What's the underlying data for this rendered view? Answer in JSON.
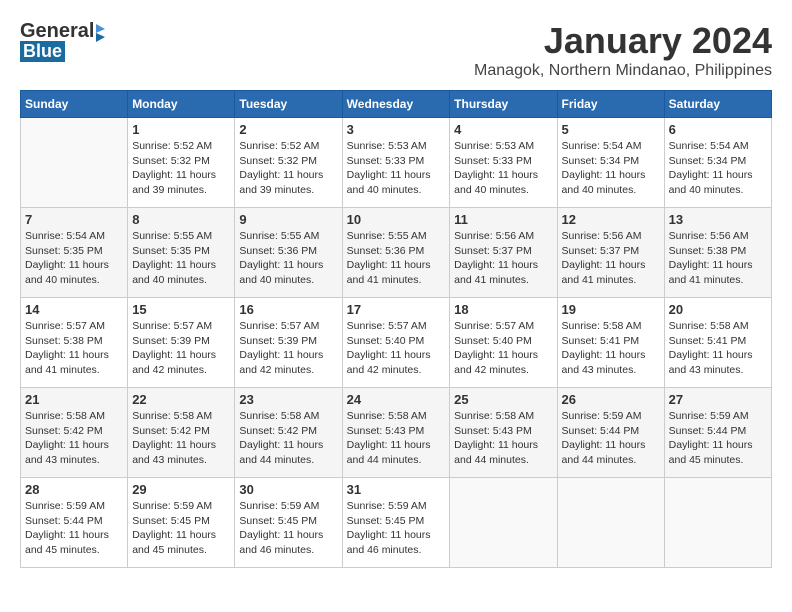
{
  "header": {
    "logo_general": "General",
    "logo_blue": "Blue",
    "month_title": "January 2024",
    "location": "Managok, Northern Mindanao, Philippines"
  },
  "weekdays": [
    "Sunday",
    "Monday",
    "Tuesday",
    "Wednesday",
    "Thursday",
    "Friday",
    "Saturday"
  ],
  "weeks": [
    [
      {
        "day": "",
        "sunrise": "",
        "sunset": "",
        "daylight": ""
      },
      {
        "day": "1",
        "sunrise": "Sunrise: 5:52 AM",
        "sunset": "Sunset: 5:32 PM",
        "daylight": "Daylight: 11 hours and 39 minutes."
      },
      {
        "day": "2",
        "sunrise": "Sunrise: 5:52 AM",
        "sunset": "Sunset: 5:32 PM",
        "daylight": "Daylight: 11 hours and 39 minutes."
      },
      {
        "day": "3",
        "sunrise": "Sunrise: 5:53 AM",
        "sunset": "Sunset: 5:33 PM",
        "daylight": "Daylight: 11 hours and 40 minutes."
      },
      {
        "day": "4",
        "sunrise": "Sunrise: 5:53 AM",
        "sunset": "Sunset: 5:33 PM",
        "daylight": "Daylight: 11 hours and 40 minutes."
      },
      {
        "day": "5",
        "sunrise": "Sunrise: 5:54 AM",
        "sunset": "Sunset: 5:34 PM",
        "daylight": "Daylight: 11 hours and 40 minutes."
      },
      {
        "day": "6",
        "sunrise": "Sunrise: 5:54 AM",
        "sunset": "Sunset: 5:34 PM",
        "daylight": "Daylight: 11 hours and 40 minutes."
      }
    ],
    [
      {
        "day": "7",
        "sunrise": "Sunrise: 5:54 AM",
        "sunset": "Sunset: 5:35 PM",
        "daylight": "Daylight: 11 hours and 40 minutes."
      },
      {
        "day": "8",
        "sunrise": "Sunrise: 5:55 AM",
        "sunset": "Sunset: 5:35 PM",
        "daylight": "Daylight: 11 hours and 40 minutes."
      },
      {
        "day": "9",
        "sunrise": "Sunrise: 5:55 AM",
        "sunset": "Sunset: 5:36 PM",
        "daylight": "Daylight: 11 hours and 40 minutes."
      },
      {
        "day": "10",
        "sunrise": "Sunrise: 5:55 AM",
        "sunset": "Sunset: 5:36 PM",
        "daylight": "Daylight: 11 hours and 41 minutes."
      },
      {
        "day": "11",
        "sunrise": "Sunrise: 5:56 AM",
        "sunset": "Sunset: 5:37 PM",
        "daylight": "Daylight: 11 hours and 41 minutes."
      },
      {
        "day": "12",
        "sunrise": "Sunrise: 5:56 AM",
        "sunset": "Sunset: 5:37 PM",
        "daylight": "Daylight: 11 hours and 41 minutes."
      },
      {
        "day": "13",
        "sunrise": "Sunrise: 5:56 AM",
        "sunset": "Sunset: 5:38 PM",
        "daylight": "Daylight: 11 hours and 41 minutes."
      }
    ],
    [
      {
        "day": "14",
        "sunrise": "Sunrise: 5:57 AM",
        "sunset": "Sunset: 5:38 PM",
        "daylight": "Daylight: 11 hours and 41 minutes."
      },
      {
        "day": "15",
        "sunrise": "Sunrise: 5:57 AM",
        "sunset": "Sunset: 5:39 PM",
        "daylight": "Daylight: 11 hours and 42 minutes."
      },
      {
        "day": "16",
        "sunrise": "Sunrise: 5:57 AM",
        "sunset": "Sunset: 5:39 PM",
        "daylight": "Daylight: 11 hours and 42 minutes."
      },
      {
        "day": "17",
        "sunrise": "Sunrise: 5:57 AM",
        "sunset": "Sunset: 5:40 PM",
        "daylight": "Daylight: 11 hours and 42 minutes."
      },
      {
        "day": "18",
        "sunrise": "Sunrise: 5:57 AM",
        "sunset": "Sunset: 5:40 PM",
        "daylight": "Daylight: 11 hours and 42 minutes."
      },
      {
        "day": "19",
        "sunrise": "Sunrise: 5:58 AM",
        "sunset": "Sunset: 5:41 PM",
        "daylight": "Daylight: 11 hours and 43 minutes."
      },
      {
        "day": "20",
        "sunrise": "Sunrise: 5:58 AM",
        "sunset": "Sunset: 5:41 PM",
        "daylight": "Daylight: 11 hours and 43 minutes."
      }
    ],
    [
      {
        "day": "21",
        "sunrise": "Sunrise: 5:58 AM",
        "sunset": "Sunset: 5:42 PM",
        "daylight": "Daylight: 11 hours and 43 minutes."
      },
      {
        "day": "22",
        "sunrise": "Sunrise: 5:58 AM",
        "sunset": "Sunset: 5:42 PM",
        "daylight": "Daylight: 11 hours and 43 minutes."
      },
      {
        "day": "23",
        "sunrise": "Sunrise: 5:58 AM",
        "sunset": "Sunset: 5:42 PM",
        "daylight": "Daylight: 11 hours and 44 minutes."
      },
      {
        "day": "24",
        "sunrise": "Sunrise: 5:58 AM",
        "sunset": "Sunset: 5:43 PM",
        "daylight": "Daylight: 11 hours and 44 minutes."
      },
      {
        "day": "25",
        "sunrise": "Sunrise: 5:58 AM",
        "sunset": "Sunset: 5:43 PM",
        "daylight": "Daylight: 11 hours and 44 minutes."
      },
      {
        "day": "26",
        "sunrise": "Sunrise: 5:59 AM",
        "sunset": "Sunset: 5:44 PM",
        "daylight": "Daylight: 11 hours and 44 minutes."
      },
      {
        "day": "27",
        "sunrise": "Sunrise: 5:59 AM",
        "sunset": "Sunset: 5:44 PM",
        "daylight": "Daylight: 11 hours and 45 minutes."
      }
    ],
    [
      {
        "day": "28",
        "sunrise": "Sunrise: 5:59 AM",
        "sunset": "Sunset: 5:44 PM",
        "daylight": "Daylight: 11 hours and 45 minutes."
      },
      {
        "day": "29",
        "sunrise": "Sunrise: 5:59 AM",
        "sunset": "Sunset: 5:45 PM",
        "daylight": "Daylight: 11 hours and 45 minutes."
      },
      {
        "day": "30",
        "sunrise": "Sunrise: 5:59 AM",
        "sunset": "Sunset: 5:45 PM",
        "daylight": "Daylight: 11 hours and 46 minutes."
      },
      {
        "day": "31",
        "sunrise": "Sunrise: 5:59 AM",
        "sunset": "Sunset: 5:45 PM",
        "daylight": "Daylight: 11 hours and 46 minutes."
      },
      {
        "day": "",
        "sunrise": "",
        "sunset": "",
        "daylight": ""
      },
      {
        "day": "",
        "sunrise": "",
        "sunset": "",
        "daylight": ""
      },
      {
        "day": "",
        "sunrise": "",
        "sunset": "",
        "daylight": ""
      }
    ]
  ]
}
